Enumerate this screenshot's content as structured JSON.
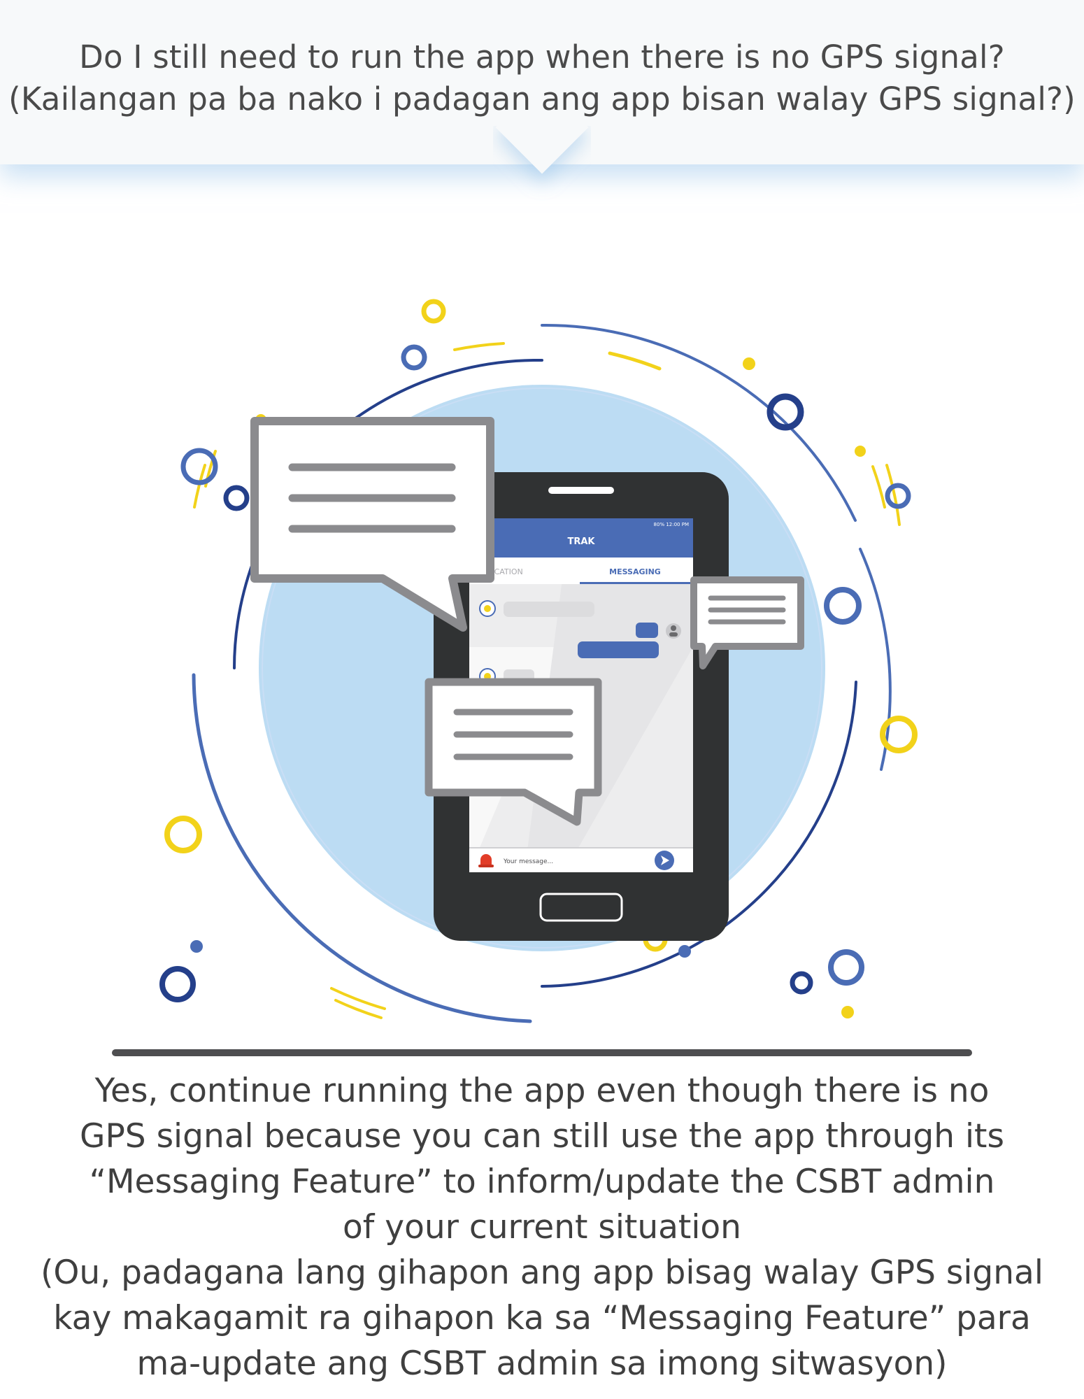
{
  "question": {
    "line_en": "Do I still need to run the app when there is no GPS signal?",
    "line_ceb": "(Kailangan pa ba nako i padagan ang app bisan walay GPS signal?)"
  },
  "phone": {
    "status_bar": "80%  12:00 PM",
    "app_title": "TRAK",
    "tabs": [
      {
        "label": "LOCATION",
        "active": false
      },
      {
        "label": "MESSAGING",
        "active": true
      }
    ],
    "composer_placeholder": "Your message..."
  },
  "colors": {
    "brand_blue": "#4a6cb5",
    "dark_navy": "#243f8a",
    "accent_yellow": "#f2d21a",
    "circle_fill": "#bcdcf3",
    "phone_body": "#303233",
    "bubble_gray": "#8b8b8e"
  },
  "icons": {
    "sos": "alarm-icon",
    "send": "send-icon",
    "contact": "user-icon",
    "admin": "admin-icon"
  },
  "answer": {
    "lines": [
      "Yes, continue running the app even though there is no",
      "GPS signal because you can still use the app through its",
      "“Messaging Feature” to inform/update the CSBT admin",
      "of your current situation",
      "(Ou, padagana lang gihapon ang app bisag walay GPS signal",
      "kay makagamit ra gihapon ka sa “Messaging Feature” para",
      "ma-update ang CSBT admin sa imong sitwasyon)"
    ]
  }
}
